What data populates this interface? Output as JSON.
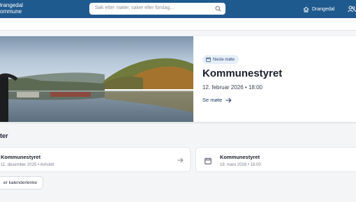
{
  "header": {
    "logo_line1": "Drangedal",
    "logo_line2": "kommune",
    "search_placeholder": "Søk etter møter, saker eller forslag...",
    "home_label": "Drangedal",
    "icons": [
      "search-icon",
      "home-icon",
      "users-icon"
    ]
  },
  "hero": {
    "badge": "Neste møte",
    "title": "Kommunestyret",
    "date": "12. februar 2026 • 18:00",
    "link_label": "Se møte",
    "colors": {
      "accent": "#1f5a8e",
      "badge_bg": "#e6eef8"
    }
  },
  "section": {
    "title": "ter",
    "cards": [
      {
        "title": "Kommunestyret",
        "subtitle": "11. desember 2025 • Avholdt",
        "icon": "arrow-right-icon"
      },
      {
        "title": "Kommunestyret",
        "subtitle": "19. mars 2026 • 18:00",
        "icon": "calendar-icon"
      }
    ],
    "calendar_button": "er kalenderlenke"
  }
}
